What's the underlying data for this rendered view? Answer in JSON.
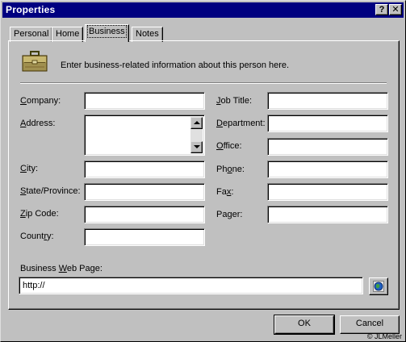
{
  "window": {
    "title": "Properties"
  },
  "titlebar_buttons": {
    "help": "?",
    "close": "✕"
  },
  "tabs": [
    {
      "label": "Personal",
      "active": false
    },
    {
      "label": "Home",
      "active": false
    },
    {
      "label": "Business",
      "active": true
    },
    {
      "label": "Notes",
      "active": false
    }
  ],
  "intro_text": "Enter business-related information about this person here.",
  "left_fields": [
    {
      "pre": "",
      "key": "C",
      "post": "ompany:",
      "value": ""
    },
    {
      "pre": "",
      "key": "A",
      "post": "ddress:",
      "value": ""
    },
    {
      "pre": "",
      "key": "C",
      "post": "ity:",
      "value": ""
    },
    {
      "pre": "",
      "key": "S",
      "post": "tate/Province:",
      "value": ""
    },
    {
      "pre": "",
      "key": "Z",
      "post": "ip Code:",
      "value": ""
    },
    {
      "pre": "Count",
      "key": "r",
      "post": "y:",
      "value": ""
    }
  ],
  "right_fields": [
    {
      "pre": "",
      "key": "J",
      "post": "ob Title:",
      "value": ""
    },
    {
      "pre": "",
      "key": "D",
      "post": "epartment:",
      "value": ""
    },
    {
      "pre": "",
      "key": "O",
      "post": "ffice:",
      "value": ""
    },
    {
      "pre": "Ph",
      "key": "o",
      "post": "ne:",
      "value": ""
    },
    {
      "pre": "Fa",
      "key": "x",
      "post": ":",
      "value": ""
    },
    {
      "pre": "Pa",
      "key": "g",
      "post": "er:",
      "value": ""
    }
  ],
  "web_page": {
    "pre": "Business ",
    "key": "W",
    "post": "eb Page:",
    "value": "http://"
  },
  "buttons": {
    "ok": "OK",
    "cancel": "Cancel"
  },
  "credit": "© JLMeller",
  "icons": {
    "briefcase": "briefcase-icon",
    "browse": "globe-browse-icon",
    "scroll_up": "scroll-up-arrow-icon",
    "scroll_down": "scroll-down-arrow-icon"
  }
}
